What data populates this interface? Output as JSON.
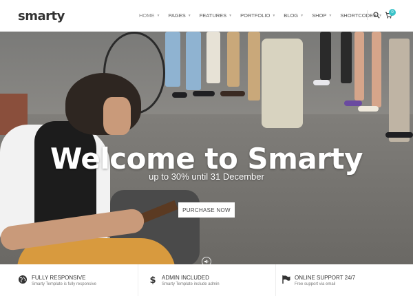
{
  "header": {
    "logo": "smarty",
    "nav": [
      {
        "label": "HOME",
        "active": true
      },
      {
        "label": "PAGES"
      },
      {
        "label": "FEATURES"
      },
      {
        "label": "PORTFOLIO"
      },
      {
        "label": "BLOG"
      },
      {
        "label": "SHOP"
      },
      {
        "label": "SHORTCODES"
      }
    ],
    "cart_count": "0",
    "accent_color": "#3ac3c9",
    "icons": [
      "search-icon",
      "cart-icon"
    ]
  },
  "hero": {
    "title": "Welcome to Smarty",
    "subtitle": "up to 30% until 31 December",
    "cta_label": "PURCHASE NOW",
    "sound_icon": "speaker-icon"
  },
  "features": [
    {
      "icon": "globe-icon",
      "title": "FULLY RESPONSIVE",
      "desc": "Smarty Template is fully responsive"
    },
    {
      "icon": "dollar-icon",
      "title": "ADMIN INCLUDED",
      "desc": "Smarty Template include admin"
    },
    {
      "icon": "flag-icon",
      "title": "ONLINE SUPPORT 24/7",
      "desc": "Free support via email"
    }
  ]
}
